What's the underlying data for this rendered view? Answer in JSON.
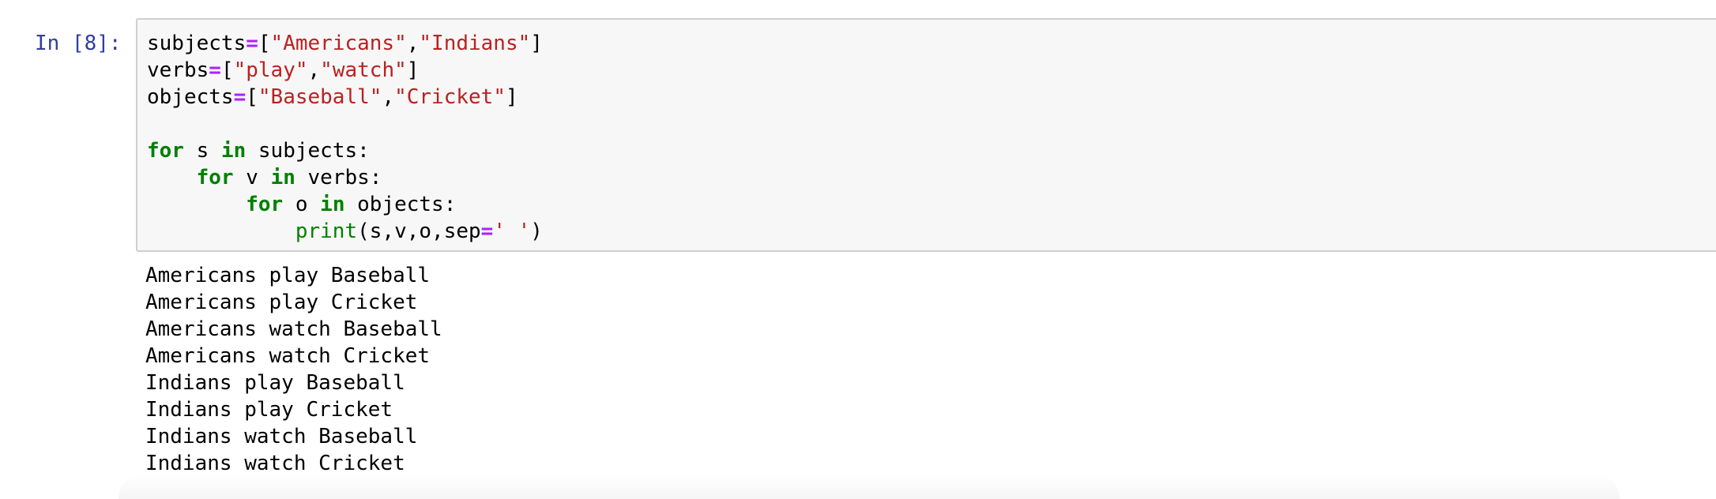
{
  "cell": {
    "prompt": "In [8]:",
    "code_lines": [
      [
        {
          "t": "subjects",
          "c": "plain"
        },
        {
          "t": "=",
          "c": "op"
        },
        {
          "t": "[",
          "c": "plain"
        },
        {
          "t": "\"Americans\"",
          "c": "str"
        },
        {
          "t": ",",
          "c": "plain"
        },
        {
          "t": "\"Indians\"",
          "c": "str"
        },
        {
          "t": "]",
          "c": "plain"
        }
      ],
      [
        {
          "t": "verbs",
          "c": "plain"
        },
        {
          "t": "=",
          "c": "op"
        },
        {
          "t": "[",
          "c": "plain"
        },
        {
          "t": "\"play\"",
          "c": "str"
        },
        {
          "t": ",",
          "c": "plain"
        },
        {
          "t": "\"watch\"",
          "c": "str"
        },
        {
          "t": "]",
          "c": "plain"
        }
      ],
      [
        {
          "t": "objects",
          "c": "plain"
        },
        {
          "t": "=",
          "c": "op"
        },
        {
          "t": "[",
          "c": "plain"
        },
        {
          "t": "\"Baseball\"",
          "c": "str"
        },
        {
          "t": ",",
          "c": "plain"
        },
        {
          "t": "\"Cricket\"",
          "c": "str"
        },
        {
          "t": "]",
          "c": "plain"
        }
      ],
      [],
      [
        {
          "t": "for",
          "c": "kw"
        },
        {
          "t": " s ",
          "c": "plain"
        },
        {
          "t": "in",
          "c": "kw"
        },
        {
          "t": " subjects:",
          "c": "plain"
        }
      ],
      [
        {
          "t": "    ",
          "c": "plain"
        },
        {
          "t": "for",
          "c": "kw"
        },
        {
          "t": " v ",
          "c": "plain"
        },
        {
          "t": "in",
          "c": "kw"
        },
        {
          "t": " verbs:",
          "c": "plain"
        }
      ],
      [
        {
          "t": "        ",
          "c": "plain"
        },
        {
          "t": "for",
          "c": "kw"
        },
        {
          "t": " o ",
          "c": "plain"
        },
        {
          "t": "in",
          "c": "kw"
        },
        {
          "t": " objects:",
          "c": "plain"
        }
      ],
      [
        {
          "t": "            ",
          "c": "plain"
        },
        {
          "t": "print",
          "c": "builtin"
        },
        {
          "t": "(s,v,o,sep",
          "c": "plain"
        },
        {
          "t": "=",
          "c": "op"
        },
        {
          "t": "' '",
          "c": "str"
        },
        {
          "t": ")",
          "c": "plain"
        }
      ]
    ],
    "output_lines": [
      "Americans play Baseball",
      "Americans play Cricket",
      "Americans watch Baseball",
      "Americans watch Cricket",
      "Indians play Baseball",
      "Indians play Cricket",
      "Indians watch Baseball",
      "Indians watch Cricket"
    ]
  },
  "colors": {
    "prompt": "#303f9f",
    "operator": "#aa22ff",
    "string": "#ba2121",
    "keyword": "#008000",
    "input_background": "#f7f7f7",
    "input_border": "#cfcfcf"
  }
}
